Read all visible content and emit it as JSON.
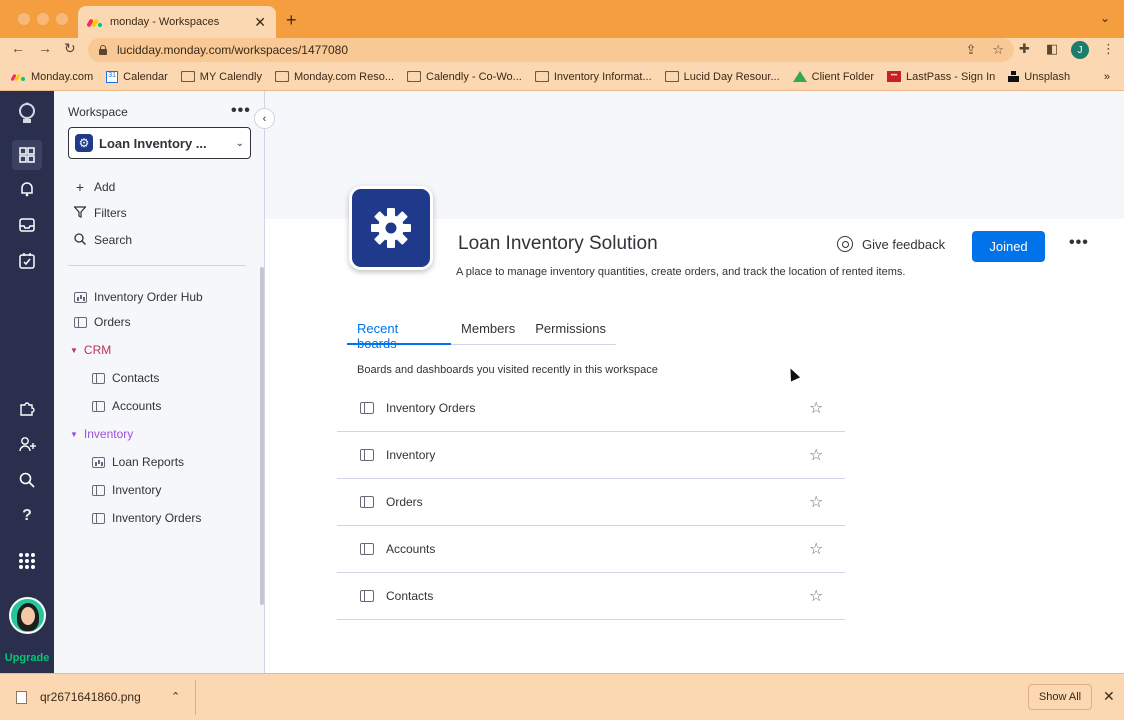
{
  "browser": {
    "tab_title": "monday - Workspaces",
    "tab_close": "✕",
    "new_tab": "+",
    "url": "lucidday.monday.com/workspaces/1477080",
    "profile_initial": "J",
    "bookmarks": [
      {
        "label": "Monday.com",
        "icon": "monday-logo"
      },
      {
        "label": "Calendar",
        "icon": "calendar"
      },
      {
        "label": "MY Calendly",
        "icon": "folder"
      },
      {
        "label": "Monday.com Reso...",
        "icon": "folder"
      },
      {
        "label": "Calendly - Co-Wo...",
        "icon": "folder"
      },
      {
        "label": "Inventory Informat...",
        "icon": "folder"
      },
      {
        "label": "Lucid Day Resour...",
        "icon": "folder"
      },
      {
        "label": "Client Folder",
        "icon": "google-drive"
      },
      {
        "label": "LastPass - Sign In",
        "icon": "lastpass"
      },
      {
        "label": "Unsplash",
        "icon": "unsplash"
      }
    ],
    "bookmarks_more": "»"
  },
  "rail": {
    "upgrade": "Upgrade"
  },
  "sidebar": {
    "workspace_label": "Workspace",
    "dots": "•••",
    "workspace_name": "Loan Inventory ...",
    "badge_icon": "⚙",
    "actions": {
      "add": "Add",
      "filters": "Filters",
      "search": "Search"
    },
    "items": {
      "hub": "Inventory Order Hub",
      "orders": "Orders",
      "crm_folder": "CRM",
      "contacts": "Contacts",
      "accounts": "Accounts",
      "inventory_folder": "Inventory",
      "loan_reports": "Loan Reports",
      "inventory": "Inventory",
      "inventory_orders": "Inventory Orders"
    }
  },
  "main": {
    "title": "Loan Inventory Solution",
    "description": "A place to manage inventory quantities, create orders, and track the location of rented items.",
    "feedback": "Give feedback",
    "joined": "Joined",
    "dots": "•••",
    "tabs": [
      "Recent boards",
      "Members",
      "Permissions"
    ],
    "hint": "Boards and dashboards you visited recently in this workspace",
    "boards": [
      "Inventory Orders",
      "Inventory",
      "Orders",
      "Accounts",
      "Contacts"
    ]
  },
  "downloads": {
    "file": "qr2671641860.png",
    "show_all": "Show All",
    "close": "✕"
  },
  "colors": {
    "accent": "#0073ea",
    "rail": "#292f4c",
    "workspace_badge": "#1f3a8a",
    "crm": "#bb3354",
    "inventory_folder": "#9d50dd",
    "upgrade": "#00ca72"
  }
}
